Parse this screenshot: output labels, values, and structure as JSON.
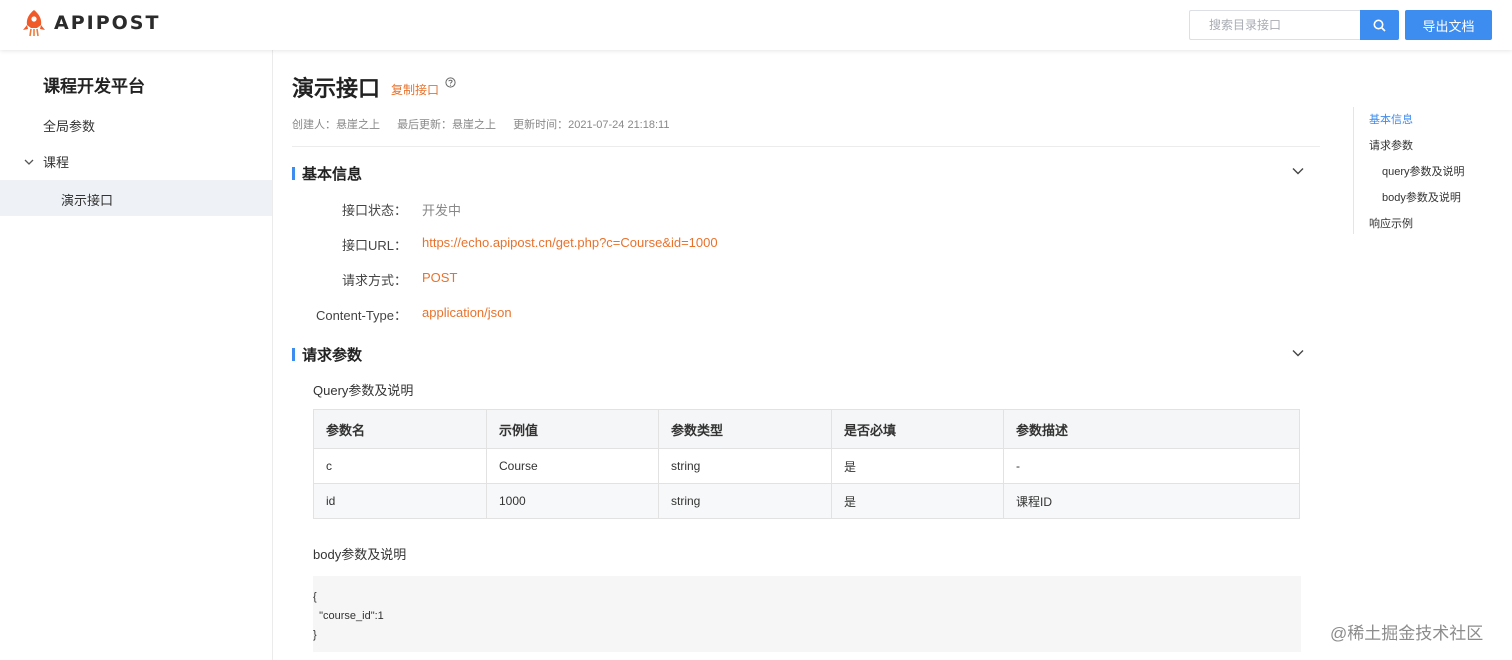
{
  "header": {
    "logo_text": "APIPOST",
    "search_placeholder": "搜索目录接口",
    "export_label": "导出文档"
  },
  "sidebar": {
    "project_title": "课程开发平台",
    "global_params": "全局参数",
    "folder": "课程",
    "active_item": "演示接口"
  },
  "api": {
    "title": "演示接口",
    "copy_label": "复制接口",
    "creator": "创建人：悬崖之上",
    "last_updated_by": "最后更新：悬崖之上",
    "updated_time": "更新时间：2021-07-24 21:18:11"
  },
  "basic_info": {
    "heading": "基本信息",
    "status_label": "接口状态：",
    "status_value": "开发中",
    "url_label": "接口URL：",
    "url_value": "https://echo.apipost.cn/get.php?c=Course&id=1000",
    "method_label": "请求方式：",
    "method_value": "POST",
    "content_type_label": "Content-Type：",
    "content_type_value": "application/json"
  },
  "request_params": {
    "heading": "请求参数",
    "query_title": "Query参数及说明",
    "columns": [
      "参数名",
      "示例值",
      "参数类型",
      "是否必填",
      "参数描述"
    ],
    "rows": [
      [
        "c",
        "Course",
        "string",
        "是",
        "-"
      ],
      [
        "id",
        "1000",
        "string",
        "是",
        "课程ID"
      ]
    ],
    "body_title": "body参数及说明",
    "body_lines": [
      "{",
      "  \"course_id\":1",
      "}"
    ]
  },
  "toc": {
    "items": [
      "基本信息",
      "请求参数",
      "query参数及说明",
      "body参数及说明",
      "响应示例"
    ]
  },
  "watermark": "@稀土掘金技术社区",
  "colors": {
    "accent": "#3d8cf0",
    "orange": "#e8722c",
    "muted": "#888888"
  }
}
